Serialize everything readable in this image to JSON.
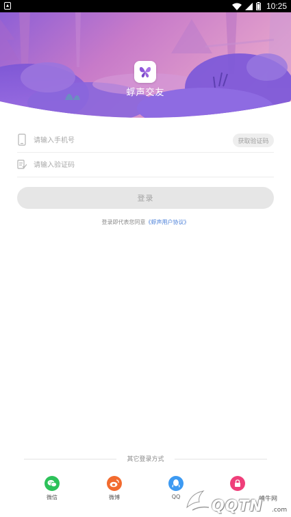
{
  "status_bar": {
    "time": "10:25"
  },
  "header": {
    "app_name": "蜉声交友",
    "logo_icon": "butterfly-icon",
    "gradient_colors": [
      "#8f6de0",
      "#c46fc4",
      "#e8a3cf"
    ]
  },
  "form": {
    "phone_placeholder": "请输入手机号",
    "code_placeholder": "请输入验证码",
    "get_code_label": "获取验证码",
    "login_label": "登录"
  },
  "agreement": {
    "prefix": "登录即代表您同意",
    "link": "《蜉声用户协议》"
  },
  "other_login": {
    "title": "其它登录方式",
    "options": [
      {
        "label": "微信",
        "icon": "wechat-icon",
        "color": "#2dc25a"
      },
      {
        "label": "微博",
        "icon": "weibo-icon",
        "color": "#f26b2f"
      },
      {
        "label": "QQ",
        "icon": "qq-icon",
        "color": "#3d9af2"
      },
      {
        "label": "",
        "icon": "lock-icon",
        "color": "#ef3f7a"
      }
    ]
  },
  "watermark": {
    "top": "蜻牛网",
    "main": "QQTN",
    "suffix": ".com"
  }
}
